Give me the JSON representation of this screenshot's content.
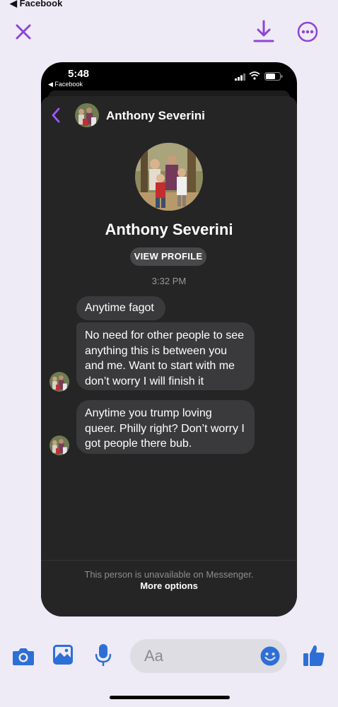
{
  "status_bar": {
    "back_app": "◀ Facebook"
  },
  "top_actions": {
    "close_icon": "close-icon",
    "download_icon": "download-icon",
    "more_icon": "more-options-icon",
    "accent": "#8e44d9"
  },
  "screenshot": {
    "time": "5:48",
    "back_app": "◀ Facebook",
    "header_name": "Anthony Severini",
    "profile_name": "Anthony Severini",
    "view_profile": "VIEW PROFILE",
    "timestamp": "3:32 PM",
    "messages": [
      "Anytime fagot",
      "No need for other people to see anything this is between you and me. Want to start with me don’t worry I will finish it",
      "Anytime you trump loving queer. Philly right? Don’t worry I got people there bub."
    ],
    "unavailable_text": "This person is unavailable on Messenger.",
    "more_options": "More options",
    "accent": "#a259ff"
  },
  "composer": {
    "placeholder": "Aa",
    "icon_color": "#2d6fd6"
  }
}
